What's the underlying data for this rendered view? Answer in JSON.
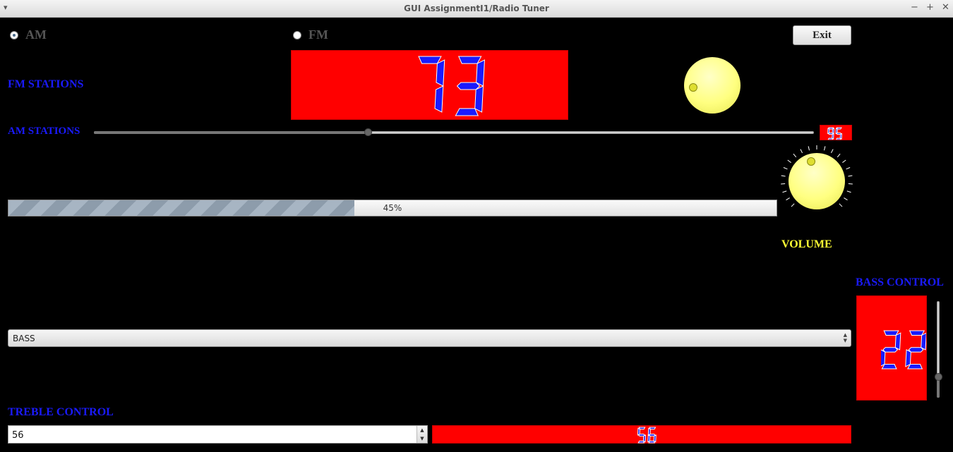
{
  "window": {
    "title": "GUI AssignmentI1/Radio Tuner",
    "menu_icon": "▾",
    "minimize": "−",
    "maximize": "+",
    "close": "✕"
  },
  "band": {
    "am_label": "AM",
    "fm_label": "FM",
    "selected": "AM"
  },
  "exit_label": "Exit",
  "fm": {
    "label": "FM STATIONS",
    "display": "73"
  },
  "am": {
    "label": "AM STATIONS",
    "value": 95,
    "min": 0,
    "max": 250,
    "display": "95"
  },
  "progress": {
    "value": 0.45,
    "text": "45%"
  },
  "volume": {
    "label": "VOLUME"
  },
  "tone_select": {
    "value": "BASS"
  },
  "bass": {
    "label": "BASS CONTROL",
    "display": "22",
    "level": 0.22
  },
  "treble": {
    "label": "TREBLE CONTROL",
    "value": "56",
    "display": "56"
  },
  "colors": {
    "display_bg": "#ff0000",
    "digit": "#1a1aff",
    "label_blue": "#1a1aff",
    "label_yellow": "#ffff33",
    "knob": "#ffff80"
  }
}
